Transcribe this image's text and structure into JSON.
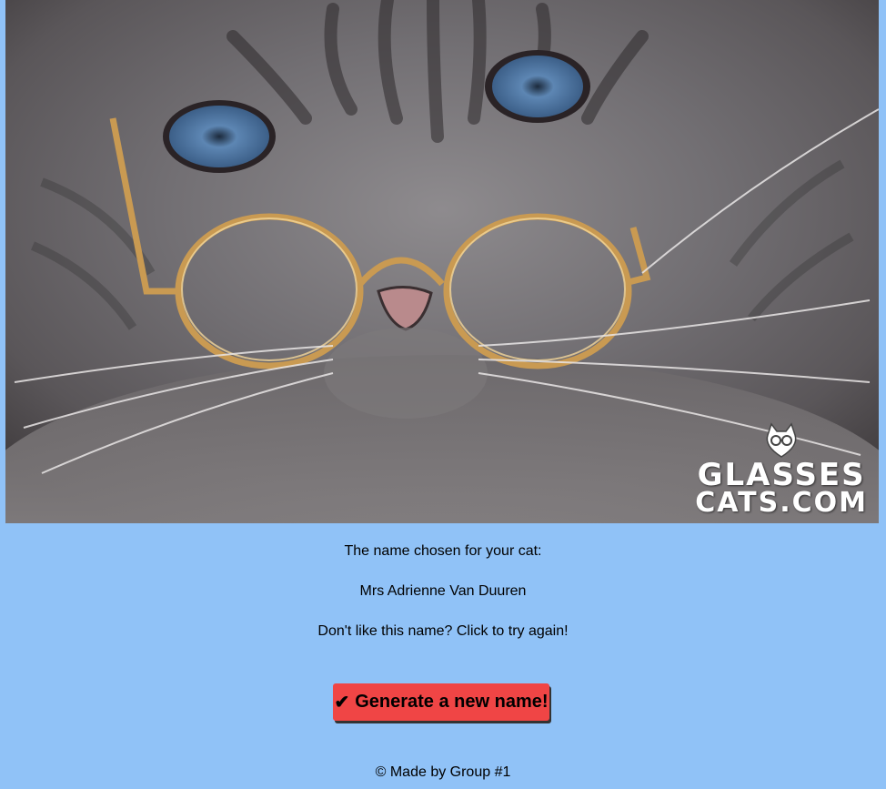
{
  "hero": {
    "image_alt": "Cat wearing round gold glasses",
    "watermark_line1": "GLASSES",
    "watermark_line2": "CATS.COM"
  },
  "content": {
    "intro": "The name chosen for your cat:",
    "cat_name": "Mrs Adrienne Van Duuren",
    "retry_prompt": "Don't like this name? Click to try again!"
  },
  "button": {
    "icon": "check-icon",
    "label": "Generate a new name!"
  },
  "footer": {
    "text": "© Made by Group #1"
  },
  "colors": {
    "page_background": "#90c2f7",
    "button_background": "#f04545"
  }
}
